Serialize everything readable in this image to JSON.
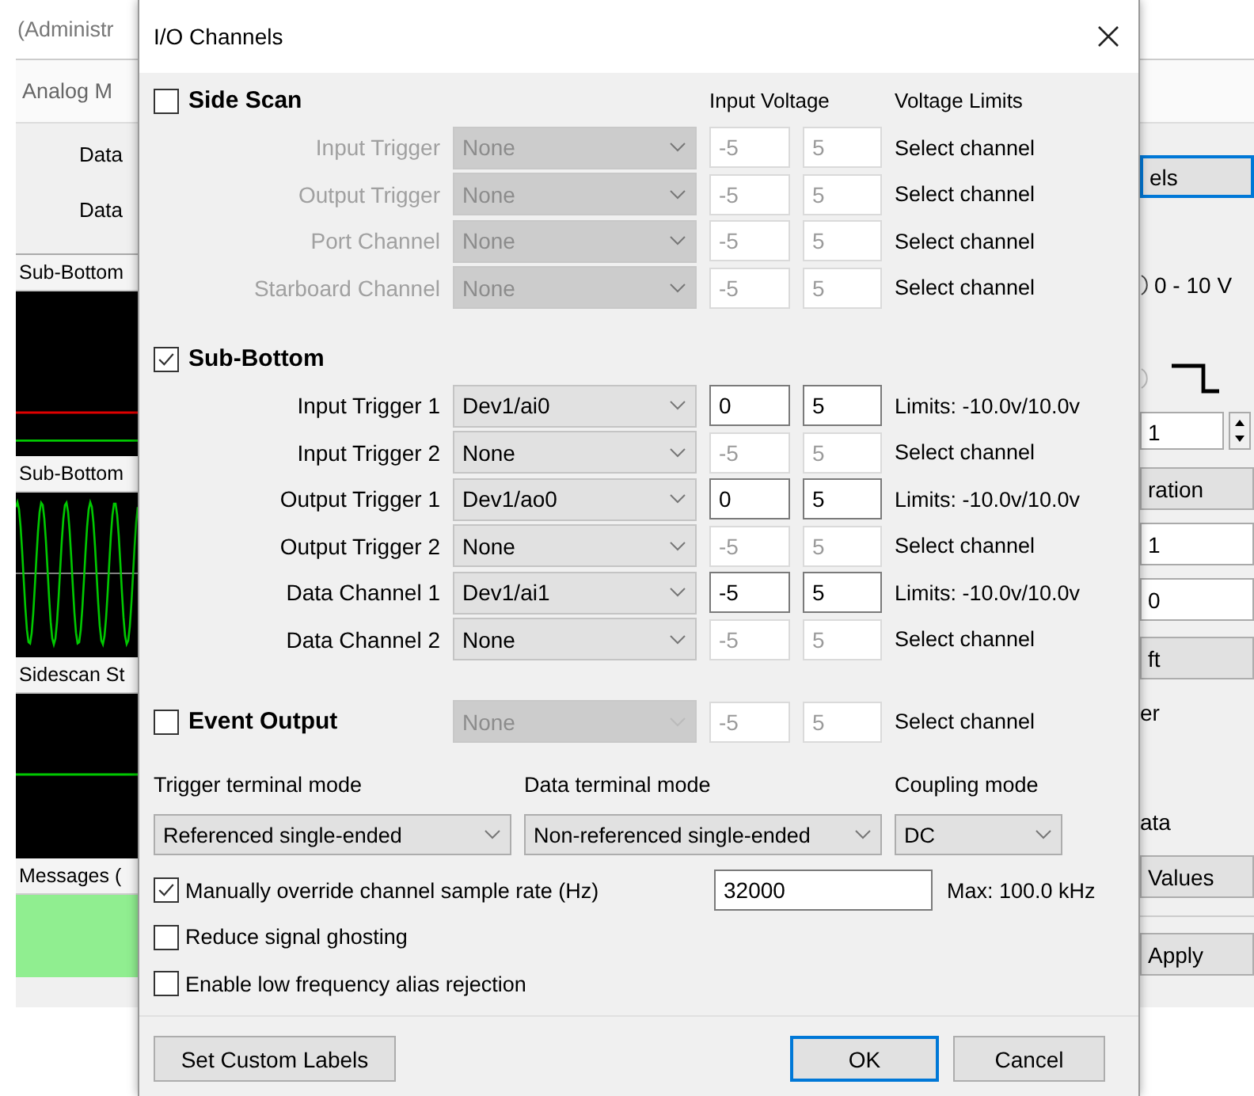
{
  "app": {
    "title": "(Administr",
    "tab": "Analog M",
    "data_labels": [
      "Data",
      "Data"
    ],
    "panels": [
      {
        "title": "Sub-Bottom",
        "kind": "lines"
      },
      {
        "title": "Sub-Bottom",
        "kind": "sine"
      },
      {
        "title": "Sidescan St",
        "kind": "flat"
      },
      {
        "title": "Messages (",
        "kind": "messages"
      }
    ],
    "right_items": [
      {
        "kind": "button",
        "label": "els",
        "focused": true
      },
      {
        "kind": "radio",
        "label": "0 - 10 V"
      },
      {
        "kind": "step"
      },
      {
        "kind": "spinner",
        "value": "1"
      },
      {
        "kind": "button",
        "label": "ration",
        "focused": false
      },
      {
        "kind": "field",
        "value": "1"
      },
      {
        "kind": "field",
        "value": "0"
      },
      {
        "kind": "button",
        "label": "ft",
        "focused": false
      },
      {
        "kind": "text",
        "label": "er"
      },
      {
        "kind": "text",
        "label": "ata"
      },
      {
        "kind": "button",
        "label": "Values",
        "focused": false
      },
      {
        "kind": "separator"
      },
      {
        "kind": "button",
        "label": "Apply",
        "focused": false
      }
    ]
  },
  "dialog": {
    "title": "I/O Channels",
    "headers": [
      "Input Voltage",
      "Voltage Limits"
    ],
    "sections": [
      {
        "label": "Side Scan",
        "checked": false,
        "rows": [
          {
            "label": "Input Trigger",
            "channel": "None",
            "min": "-5",
            "max": "5",
            "limits": "Select channel",
            "active": false
          },
          {
            "label": "Output Trigger",
            "channel": "None",
            "min": "-5",
            "max": "5",
            "limits": "Select channel",
            "active": false
          },
          {
            "label": "Port Channel",
            "channel": "None",
            "min": "-5",
            "max": "5",
            "limits": "Select channel",
            "active": false
          },
          {
            "label": "Starboard Channel",
            "channel": "None",
            "min": "-5",
            "max": "5",
            "limits": "Select channel",
            "active": false
          }
        ]
      },
      {
        "label": "Sub-Bottom",
        "checked": true,
        "rows": [
          {
            "label": "Input Trigger 1",
            "channel": "Dev1/ai0",
            "min": "0",
            "max": "5",
            "limits": "Limits: -10.0v/10.0v",
            "active": true
          },
          {
            "label": "Input Trigger 2",
            "channel": "None",
            "min": "-5",
            "max": "5",
            "limits": "Select channel",
            "active": false
          },
          {
            "label": "Output Trigger 1",
            "channel": "Dev1/ao0",
            "min": "0",
            "max": "5",
            "limits": "Limits: -10.0v/10.0v",
            "active": true
          },
          {
            "label": "Output Trigger 2",
            "channel": "None",
            "min": "-5",
            "max": "5",
            "limits": "Select channel",
            "active": false
          },
          {
            "label": "Data Channel 1",
            "channel": "Dev1/ai1",
            "min": "-5",
            "max": "5",
            "limits": "Limits: -10.0v/10.0v",
            "active": true
          },
          {
            "label": "Data Channel 2",
            "channel": "None",
            "min": "-5",
            "max": "5",
            "limits": "Select channel",
            "active": false
          }
        ]
      }
    ],
    "event_output": {
      "label": "Event Output",
      "checked": false,
      "channel": "None",
      "min": "-5",
      "max": "5",
      "limits": "Select channel"
    },
    "modes": [
      {
        "label": "Trigger terminal mode",
        "value": "Referenced single-ended"
      },
      {
        "label": "Data terminal mode",
        "value": "Non-referenced single-ended"
      },
      {
        "label": "Coupling mode",
        "value": "DC"
      }
    ],
    "options": [
      {
        "label": "Manually override channel sample rate (Hz)",
        "checked": true,
        "value": "32000",
        "note": "Max: 100.0 kHz"
      },
      {
        "label": "Reduce signal ghosting",
        "checked": false
      },
      {
        "label": "Enable low frequency alias rejection",
        "checked": false
      }
    ],
    "buttons": [
      {
        "label": "Set Custom Labels",
        "kind": "secondary"
      },
      {
        "label": "OK",
        "kind": "default"
      },
      {
        "label": "Cancel",
        "kind": "secondary"
      }
    ]
  }
}
